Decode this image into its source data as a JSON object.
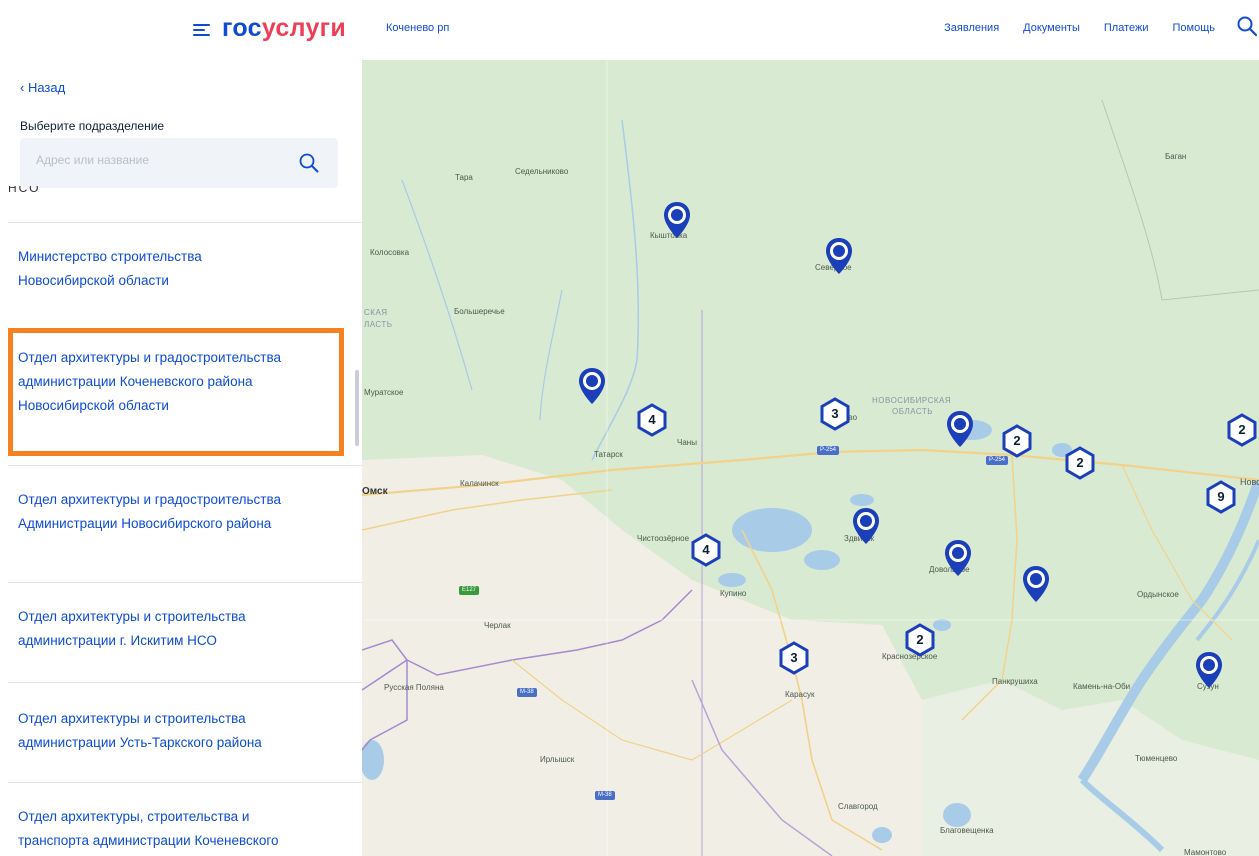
{
  "header": {
    "logo_part1": "гос",
    "logo_part2": "услуги",
    "location": "Коченево рп",
    "nav": [
      "Заявления",
      "Документы",
      "Платежи",
      "Помощь"
    ]
  },
  "sidebar": {
    "back_label": "‹ Назад",
    "subtitle": "Выберите подразделение",
    "search_placeholder": "Адрес или название",
    "cut_text": "НСО",
    "items": [
      {
        "label": "Министерство строительства Новосибирской области"
      },
      {
        "label": "Отдел архитектуры и градостроительства администрации Коченевского района Новосибирской области"
      },
      {
        "label": "Отдел архитектуры и градостроительства Администрации Новосибирского района"
      },
      {
        "label": "Отдел архитектуры и строительства администрации г. Искитим НСО"
      },
      {
        "label": "Отдел архитектуры и строительства администрации Усть-Таркского района"
      },
      {
        "label": "Отдел архитектуры, строительства и транспорта администрации Коченевского района НСО"
      }
    ]
  },
  "map": {
    "labels": [
      {
        "text": "Тара"
      },
      {
        "text": "Седельниково"
      },
      {
        "text": "Баган"
      },
      {
        "text": "Колосовка"
      },
      {
        "text": "Кыштовка"
      },
      {
        "text": "Северное"
      },
      {
        "text": "Большеречье"
      },
      {
        "text": "СКАЯ"
      },
      {
        "text": "ЛАСТЬ"
      },
      {
        "text": "Муратское"
      },
      {
        "text": "НОВОСИБИРСКАЯ"
      },
      {
        "text": "ОБЛАСТЬ"
      },
      {
        "text": "Татарск"
      },
      {
        "text": "Чаны"
      },
      {
        "text": "Калачинск"
      },
      {
        "text": "Омск"
      },
      {
        "text": "Чистоозёрное"
      },
      {
        "text": "Здвинск"
      },
      {
        "text": "Довольное"
      },
      {
        "text": "Купино"
      },
      {
        "text": "Черлак"
      },
      {
        "text": "Ордынское"
      },
      {
        "text": "Краснозерское"
      },
      {
        "text": "Русская Поляна"
      },
      {
        "text": "Карасук"
      },
      {
        "text": "Панкрушиха"
      },
      {
        "text": "Камень-на-Оби"
      },
      {
        "text": "Сузун"
      },
      {
        "text": "Ирлышск"
      },
      {
        "text": "Тюменцево"
      },
      {
        "text": "Славгород"
      },
      {
        "text": "Благовещенка"
      },
      {
        "text": "Мамонтово"
      },
      {
        "text": "Коченёво"
      },
      {
        "text": "Новосибирск"
      }
    ],
    "routes": [
      "P-254",
      "P-254",
      "E127",
      "M-38",
      "M-38"
    ],
    "clusters": [
      {
        "count": "4"
      },
      {
        "count": "3"
      },
      {
        "count": "2"
      },
      {
        "count": "2"
      },
      {
        "count": "2"
      },
      {
        "count": "9"
      },
      {
        "count": "4"
      },
      {
        "count": "3"
      },
      {
        "count": "2"
      }
    ]
  },
  "colors": {
    "brand_blue": "#0d4cd3",
    "brand_red": "#ee3f58",
    "highlight_orange": "#f58220",
    "pin_blue": "#1a3fb8"
  }
}
